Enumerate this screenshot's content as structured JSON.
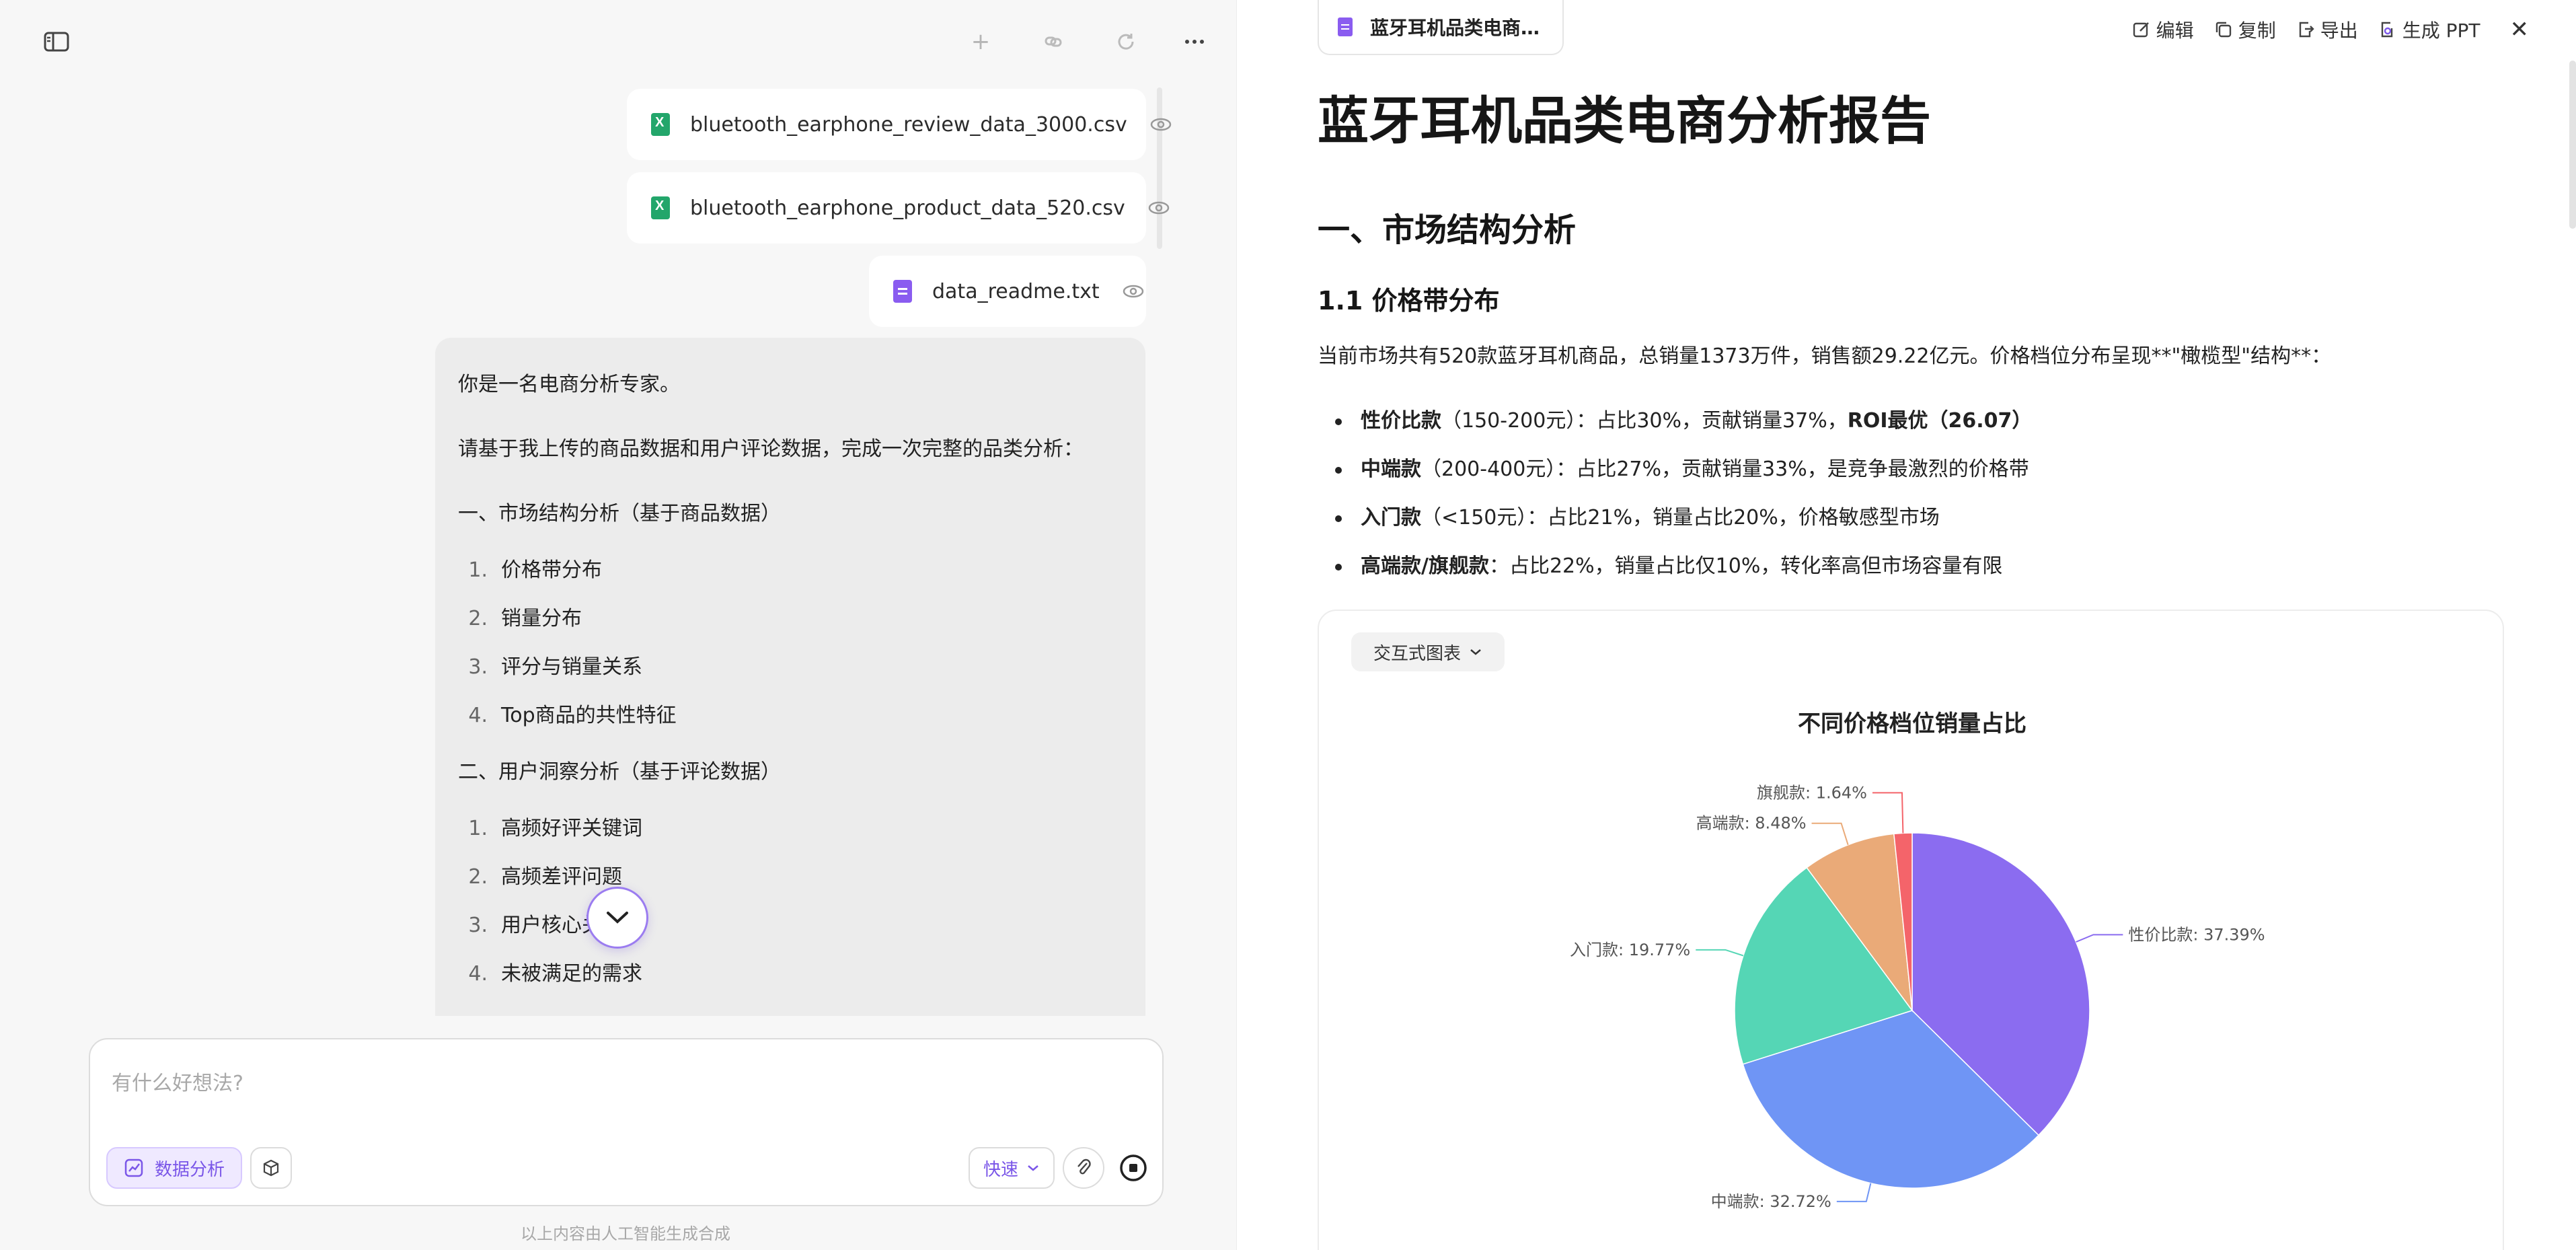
{
  "left": {
    "files": [
      {
        "name": "bluetooth_earphone_review_data_3000.csv",
        "type": "csv"
      },
      {
        "name": "bluetooth_earphone_product_data_520.csv",
        "type": "csv"
      },
      {
        "name": "data_readme.txt",
        "type": "txt"
      }
    ],
    "message": {
      "intro": "你是一名电商分析专家。",
      "request": "请基于我上传的商品数据和用户评论数据，完成一次完整的品类分析：",
      "section1_title": "一、市场结构分析（基于商品数据）",
      "section1_items": [
        "价格带分布",
        "销量分布",
        "评分与销量关系",
        "Top商品的共性特征"
      ],
      "section2_title": "二、用户洞察分析（基于评论数据）",
      "section2_items": [
        "高频好评关键词",
        "高频差评问题",
        "用户核心关注点",
        "未被满足的需求"
      ]
    },
    "composer": {
      "placeholder": "有什么好想法?",
      "data_analysis_label": "数据分析",
      "speed_label": "快速"
    },
    "disclaimer": "以上内容由人工智能生成合成"
  },
  "right": {
    "doc_tab_title": "蓝牙耳机品类电商…",
    "actions": {
      "edit": "编辑",
      "copy": "复制",
      "export": "导出",
      "ppt": "生成 PPT"
    },
    "h1": "蓝牙耳机品类电商分析报告",
    "h2": "一、市场结构分析",
    "h3": "1.1 价格带分布",
    "paragraph": "当前市场共有520款蓝牙耳机商品，总销量1373万件，销售额29.22亿元。价格档位分布呈现**\"橄榄型\"结构**：",
    "bullets": [
      {
        "bold": "性价比款",
        "text": "（150-200元）：占比30%，贡献销量37%，",
        "bold2": "ROI最优（26.07）"
      },
      {
        "bold": "中端款",
        "text": "（200-400元）：占比27%，贡献销量33%，是竞争最激烈的价格带",
        "bold2": ""
      },
      {
        "bold": "入门款",
        "text": "（<150元）：占比21%，销量占比20%，价格敏感型市场",
        "bold2": ""
      },
      {
        "bold": "高端款/旗舰款",
        "text": "：占比22%，销量占比仅10%，转化率高但市场容量有限",
        "bold2": ""
      }
    ],
    "chart_select_label": "交互式图表"
  },
  "chart_data": {
    "type": "pie",
    "title": "不同价格档位销量占比",
    "slices": [
      {
        "label": "性价比款",
        "value": 37.39,
        "color": "#8b6cf0",
        "display": "性价比款: 37.39%"
      },
      {
        "label": "中端款",
        "value": 32.72,
        "color": "#6f95f5",
        "display": "中端款: 32.72%"
      },
      {
        "label": "入门款",
        "value": 19.77,
        "color": "#55d6b5",
        "display": "入门款: 19.77%"
      },
      {
        "label": "高端款",
        "value": 8.48,
        "color": "#eaaa78",
        "display": "高端款: 8.48%"
      },
      {
        "label": "旗舰款",
        "value": 1.64,
        "color": "#f4646a",
        "display": "旗舰款: 1.64%"
      }
    ]
  }
}
